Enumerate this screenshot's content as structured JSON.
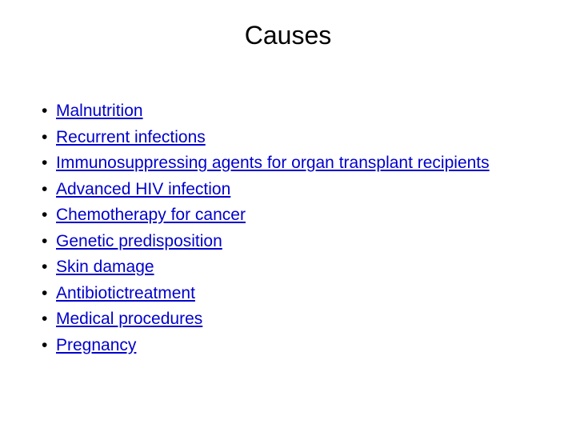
{
  "slide": {
    "title": "Causes",
    "link_color": "#0000cc",
    "bullets": [
      {
        "label": "Malnutrition"
      },
      {
        "label": "Recurrent infections"
      },
      {
        "label": "Immunosuppressing agents for organ transplant recipients"
      },
      {
        "label": "Advanced HIV infection"
      },
      {
        "label": "Chemotherapy for cancer"
      },
      {
        "label": "Genetic predisposition"
      },
      {
        "label": "Skin damage"
      },
      {
        "label": "Antibiotictreatment"
      },
      {
        "label": "Medical procedures"
      },
      {
        "label": "Pregnancy"
      }
    ],
    "bullet_glyph": "•"
  }
}
